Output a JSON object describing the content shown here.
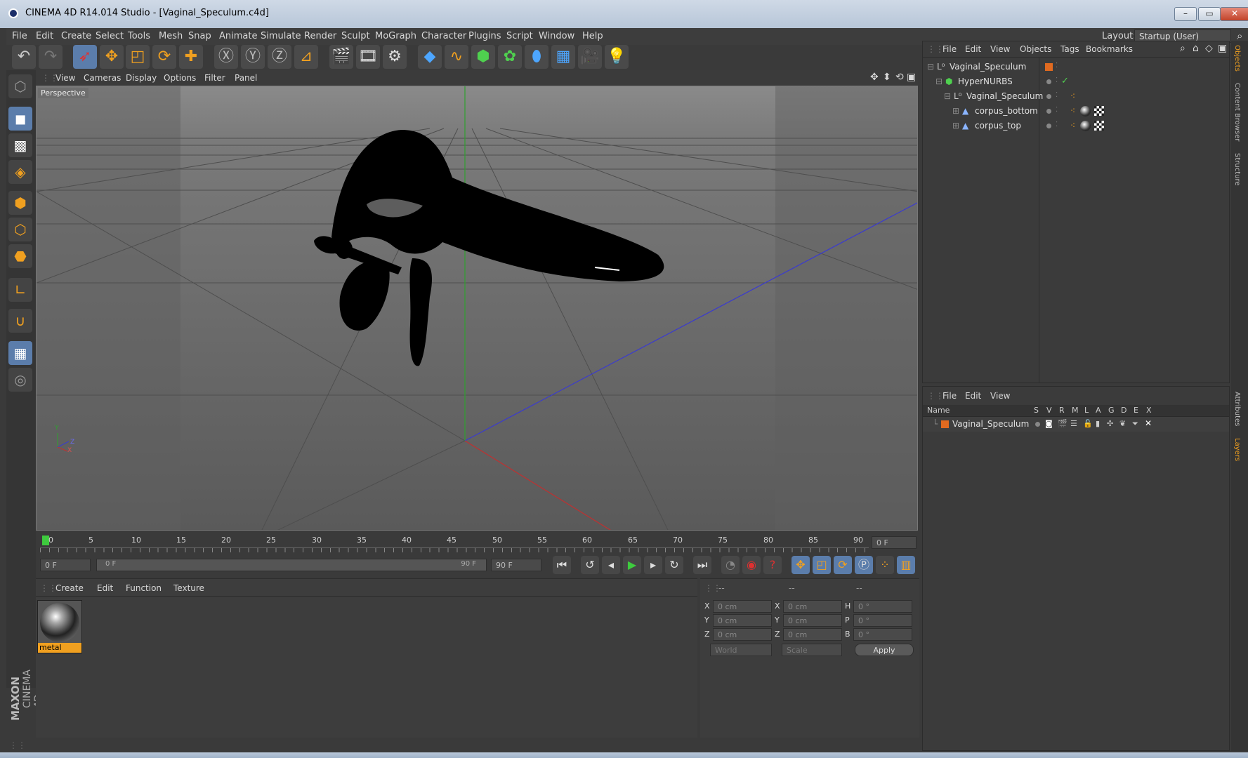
{
  "window": {
    "title": "CINEMA 4D R14.014 Studio - [Vaginal_Speculum.c4d]",
    "min": "–",
    "max": "▭",
    "close": "✕"
  },
  "menu": [
    "File",
    "Edit",
    "Create",
    "Select",
    "Tools",
    "Mesh",
    "Snap",
    "Animate",
    "Simulate",
    "Render",
    "Sculpt",
    "MoGraph",
    "Character",
    "Plugins",
    "Script",
    "Window",
    "Help"
  ],
  "layout": {
    "label": "Layout:",
    "value": "Startup (User)"
  },
  "viewport": {
    "menu": [
      "View",
      "Cameras",
      "Display",
      "Options",
      "Filter",
      "Panel"
    ],
    "label": "Perspective",
    "axis_y": "Y",
    "axis_z": "Z",
    "axis_x": "X"
  },
  "timeline": {
    "ticks": [
      "0",
      "5",
      "10",
      "15",
      "20",
      "25",
      "30",
      "35",
      "40",
      "45",
      "50",
      "55",
      "60",
      "65",
      "70",
      "75",
      "80",
      "85",
      "90"
    ],
    "frame_field": "0 F",
    "current": 0,
    "max": 90
  },
  "transport": {
    "start": "0 F",
    "range_start": "0 F",
    "range_end": "90 F",
    "end": "90 F"
  },
  "material": {
    "menu": [
      "Create",
      "Edit",
      "Function",
      "Texture"
    ],
    "name": "metal"
  },
  "coords": {
    "headers": [
      "--",
      "--",
      "--"
    ],
    "rows": [
      {
        "a": "X",
        "av": "0 cm",
        "b": "X",
        "bv": "0 cm",
        "c": "H",
        "cv": "0 °"
      },
      {
        "a": "Y",
        "av": "0 cm",
        "b": "Y",
        "bv": "0 cm",
        "c": "P",
        "cv": "0 °"
      },
      {
        "a": "Z",
        "av": "0 cm",
        "b": "Z",
        "bv": "0 cm",
        "c": "B",
        "cv": "0 °"
      }
    ],
    "world": "World",
    "scale": "Scale",
    "apply": "Apply"
  },
  "objects": {
    "menu": [
      "File",
      "Edit",
      "View",
      "Objects",
      "Tags",
      "Bookmarks"
    ],
    "items": [
      {
        "name": "Vaginal_Speculum",
        "indent": 0
      },
      {
        "name": "HyperNURBS",
        "indent": 1
      },
      {
        "name": "Vaginal_Speculum",
        "indent": 2
      },
      {
        "name": "corpus_bottom",
        "indent": 3
      },
      {
        "name": "corpus_top",
        "indent": 3
      }
    ]
  },
  "layers": {
    "menu": [
      "File",
      "Edit",
      "View"
    ],
    "headers": [
      "Name",
      "S",
      "V",
      "R",
      "M",
      "L",
      "A",
      "G",
      "D",
      "E",
      "X"
    ],
    "items": [
      {
        "name": "Vaginal_Speculum"
      }
    ]
  },
  "sidetabs": [
    "Objects",
    "Content Browser",
    "Structure",
    "Attributes",
    "Layers"
  ],
  "brand": {
    "line1": "MAXON",
    "line2": "CINEMA 4D"
  }
}
